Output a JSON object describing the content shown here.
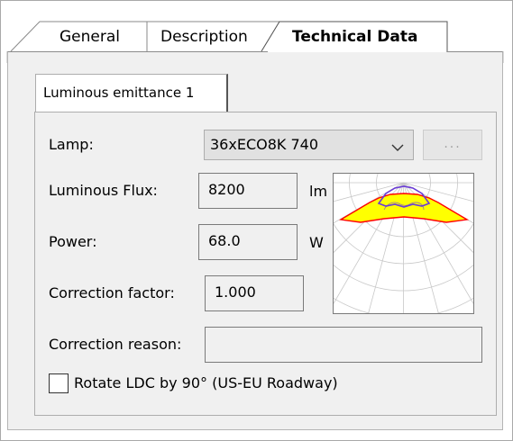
{
  "tabs": [
    {
      "label": "General"
    },
    {
      "label": "Description"
    },
    {
      "label": "Technical Data"
    }
  ],
  "active_tab": "Technical Data",
  "subtab": {
    "label": "Luminous emittance 1"
  },
  "form": {
    "lamp": {
      "label": "Lamp:",
      "value": "36xECO8K 740",
      "button": "..."
    },
    "luminous_flux": {
      "label": "Luminous Flux:",
      "value": "8200",
      "unit": "lm"
    },
    "power": {
      "label": "Power:",
      "value": "68.0",
      "unit": "W"
    },
    "correction_factor": {
      "label": "Correction factor:",
      "value": "1.000"
    },
    "correction_reason": {
      "label": "Correction reason:",
      "value": ""
    },
    "rotate_ldc": {
      "label": "Rotate LDC by 90° (US-EU Roadway)",
      "checked": false
    }
  },
  "icons": {
    "combo_arrow": "chevron-down-icon",
    "ldc_preview": "light-distribution-curve"
  },
  "colors": {
    "ldc_fill": "#ffff00",
    "ldc_curve_c0": "#ff0000",
    "ldc_curve_c90": "#6a3bd6",
    "grid": "#c8c8c8"
  }
}
